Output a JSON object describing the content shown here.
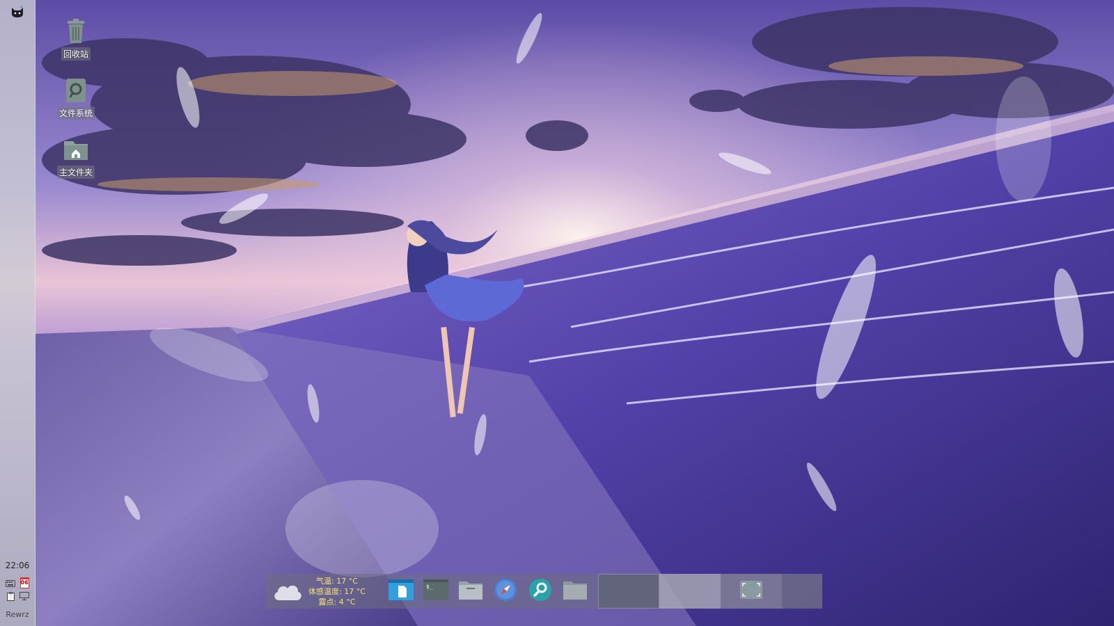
{
  "desktop": {
    "icons": [
      {
        "name": "trash",
        "label": "回收站",
        "icon": "trash-icon"
      },
      {
        "name": "filesystem",
        "label": "文件系统",
        "icon": "drive-icon"
      },
      {
        "name": "home",
        "label": "主文件夹",
        "icon": "home-folder-icon"
      }
    ]
  },
  "left_panel": {
    "menu_icon": "cat-logo-icon",
    "clock": "22:06",
    "calendar_day": "06",
    "user": "Rewrz"
  },
  "dock": {
    "weather": {
      "icon": "cloud-icon",
      "temperature": "气温: 17 °C",
      "feels_like": "体感温度: 17 °C",
      "dew_point": "露点: 4 °C",
      "text_color": "#f5e27a"
    },
    "apps": [
      {
        "name": "text-editor",
        "icon": "text-editor-icon"
      },
      {
        "name": "terminal",
        "icon": "terminal-icon"
      },
      {
        "name": "file-manager",
        "icon": "file-manager-icon"
      },
      {
        "name": "web-browser",
        "icon": "compass-icon"
      },
      {
        "name": "search",
        "icon": "search-icon"
      },
      {
        "name": "folder",
        "icon": "folder-icon"
      }
    ]
  },
  "colors": {
    "panel": "#cdcdd4",
    "accent_blue": "#2f9fe0",
    "sky_top": "#5a4aa0",
    "sea": "#4b3d9a"
  }
}
